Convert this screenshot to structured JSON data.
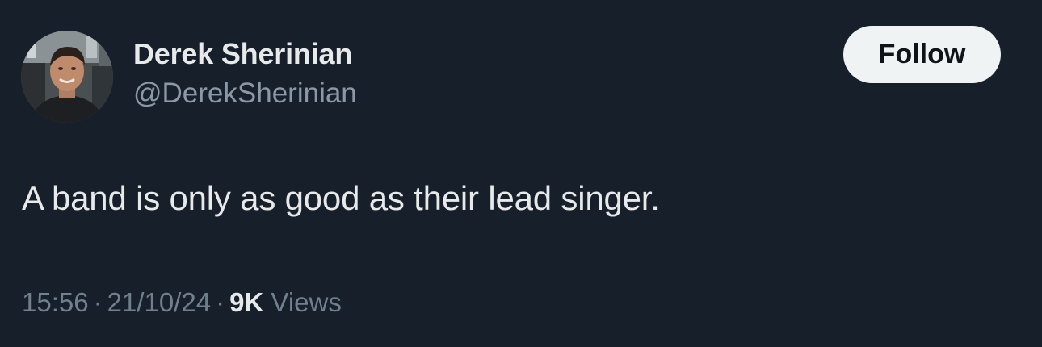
{
  "author": {
    "display_name": "Derek Sherinian",
    "handle": "@DerekSherinian",
    "avatar_icon": "profile-photo"
  },
  "follow_button": {
    "label": "Follow"
  },
  "tweet": {
    "text": "A band is only as good as their lead singer."
  },
  "meta": {
    "time": "15:56",
    "separator": "·",
    "date": "21/10/24",
    "views_count": "9K",
    "views_label": "Views"
  },
  "colors": {
    "background": "#17202a",
    "primary_text": "#e7e9ea",
    "secondary_text": "#8b98a5",
    "button_bg": "#eff3f4",
    "button_text": "#0f1419"
  }
}
